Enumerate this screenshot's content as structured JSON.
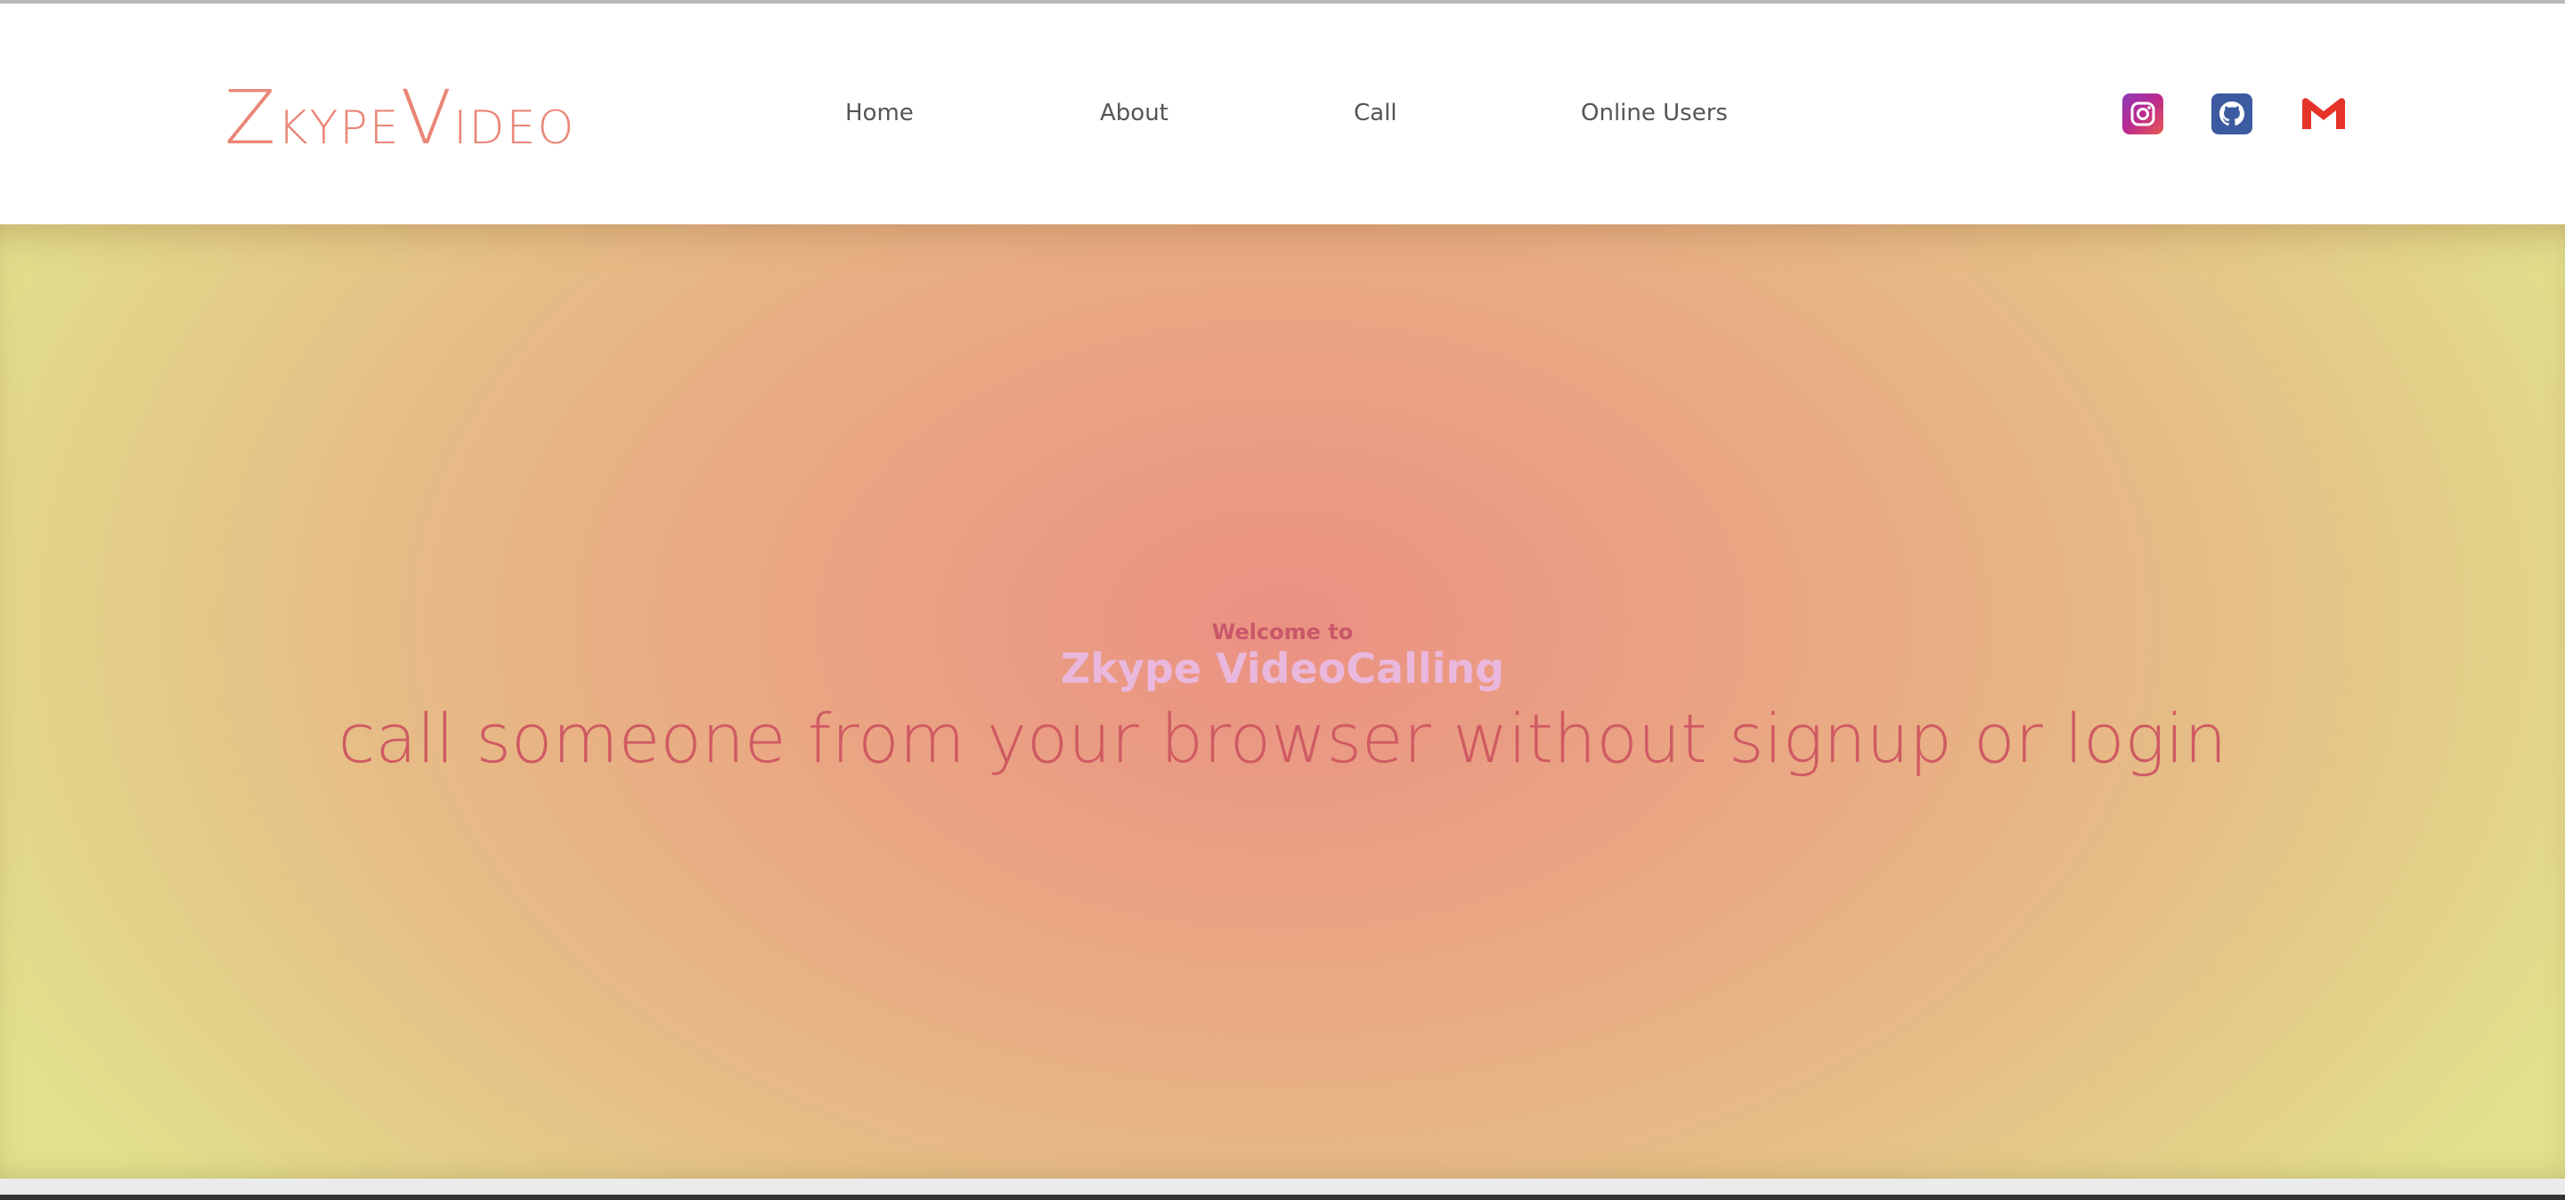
{
  "logo": {
    "first_letter": "Z",
    "first_rest": "kype",
    "second_letter": "V",
    "second_rest": "ideo"
  },
  "nav": {
    "items": [
      {
        "label": "Home"
      },
      {
        "label": "About"
      },
      {
        "label": "Call"
      },
      {
        "label": "Online Users"
      }
    ]
  },
  "social": [
    {
      "icon": "instagram-icon",
      "color": "#bc2a8d"
    },
    {
      "icon": "github-icon",
      "color": "#3c5aa0"
    },
    {
      "icon": "gmail-icon",
      "color": "#e5332a"
    }
  ],
  "hero": {
    "welcome": "Welcome to",
    "brand": "Zkype VideoCalling",
    "tagline": "call someone from your browser without signup or login"
  },
  "colors": {
    "accent": "#ea8677",
    "tagline": "#cf5a63",
    "brand": "#e9b8dc",
    "gradient_center": "#eb9183",
    "gradient_edge": "#e1e08c"
  }
}
